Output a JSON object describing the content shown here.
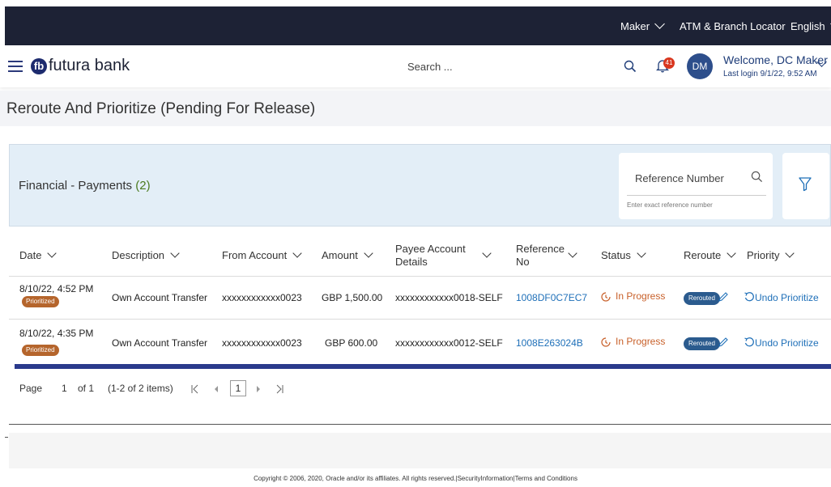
{
  "topbar": {
    "maker": "Maker",
    "locator": "ATM & Branch Locator",
    "language": "English"
  },
  "header": {
    "logo_mark": "fb",
    "logo_text": "futura bank",
    "search_placeholder": "Search ...",
    "notification_count": "41",
    "avatar_initials": "DM",
    "welcome": "Welcome, DC Maker",
    "last_login": "Last login 9/1/22, 9:52 AM"
  },
  "page": {
    "title": "Reroute And Prioritize (Pending For Release)"
  },
  "panel": {
    "title": "Financial - Payments",
    "count": "(2)",
    "search_label": "Reference Number",
    "search_hint": "Enter exact reference number"
  },
  "table": {
    "columns": {
      "date": "Date",
      "description": "Description",
      "from_account": "From Account",
      "amount": "Amount",
      "payee_line1": "Payee Account",
      "payee_line2": "Details",
      "reference_line1": "Reference",
      "reference_line2": "No",
      "status": "Status",
      "reroute": "Reroute",
      "priority": "Priority"
    },
    "rows": [
      {
        "date": "8/10/22, 4:52 PM",
        "tag": "Prioritized",
        "description": "Own Account Transfer",
        "from_account": "xxxxxxxxxxxx0023",
        "amount": "GBP 1,500.00",
        "payee": "xxxxxxxxxxxx0018-SELF",
        "reference": "1008DF0C7EC7",
        "status": "In Progress",
        "reroute": "Rerouted",
        "priority": "Undo Prioritize"
      },
      {
        "date": "8/10/22, 4:35 PM",
        "tag": "Prioritized",
        "description": "Own Account Transfer",
        "from_account": "xxxxxxxxxxxx0023",
        "amount": "GBP 600.00",
        "payee": "xxxxxxxxxxxx0012-SELF",
        "reference": "1008E263024B",
        "status": "In Progress",
        "reroute": "Rerouted",
        "priority": "Undo Prioritize"
      }
    ]
  },
  "pager": {
    "page_label": "Page",
    "current": "1",
    "of_total": "of 1",
    "items": "(1-2 of 2 items)",
    "selected_page": "1"
  },
  "footer": {
    "copyright": "Copyright © 2006, 2020, Oracle and/or its affiliates. All rights reserved.|SecurityInformation|Terms and Conditions"
  }
}
